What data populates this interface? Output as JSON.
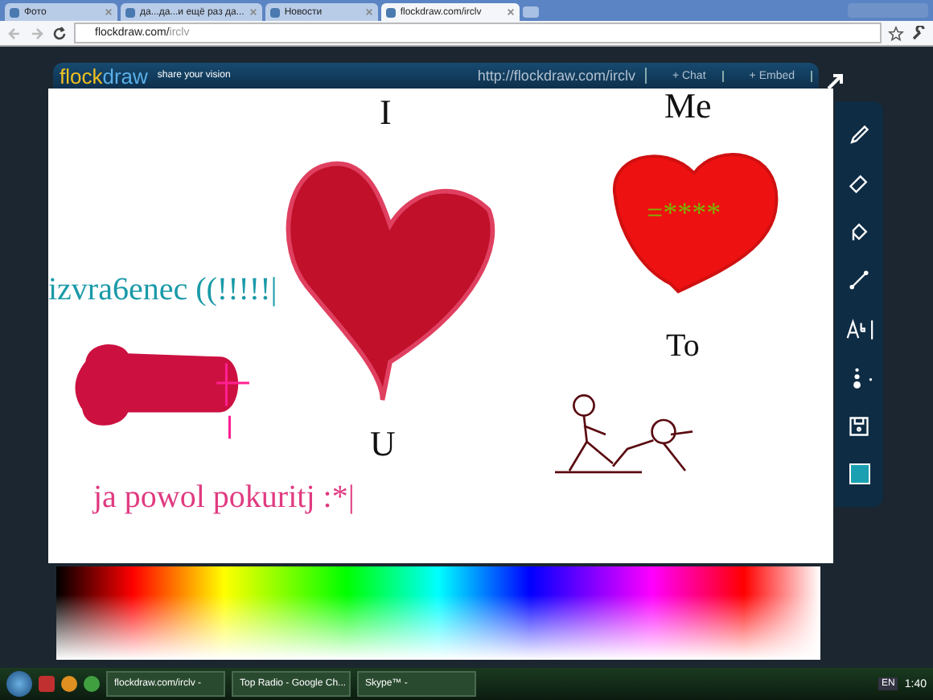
{
  "browser": {
    "tabs": [
      {
        "title": "Фото",
        "selected": false
      },
      {
        "title": "да...да...и ещё раз да...",
        "selected": false
      },
      {
        "title": "Новости",
        "selected": false
      },
      {
        "title": "flockdraw.com/irclv",
        "selected": true
      }
    ],
    "address": {
      "domain": "flockdraw.com/",
      "path": "irclv"
    }
  },
  "header": {
    "logo_a": "flock",
    "logo_b": "draw",
    "tagline": "share your vision",
    "room_url": "http://flockdraw.com/irclv",
    "buttons": [
      "+ Chat",
      "+ Embed"
    ]
  },
  "canvas": {
    "texts": [
      {
        "text": "I",
        "color": "#111111"
      },
      {
        "text": "Me",
        "color": "#111111"
      },
      {
        "text": "izvra6enec ((!!!!!|",
        "color": "#1a9aa8"
      },
      {
        "text": "=****",
        "color": "#7ab800"
      },
      {
        "text": "To",
        "color": "#111111"
      },
      {
        "text": "U",
        "color": "#111111"
      },
      {
        "text": "ja powol pokuritj :*|",
        "color": "#e03a80"
      }
    ]
  },
  "tools": [
    {
      "kind": "pencil"
    },
    {
      "kind": "eraser"
    },
    {
      "kind": "fill"
    },
    {
      "kind": "line"
    },
    {
      "kind": "text"
    },
    {
      "kind": "size"
    },
    {
      "kind": "save"
    },
    {
      "kind": "color",
      "color": "#1aa0b0"
    }
  ],
  "taskbar": {
    "items": [
      "flockdraw.com/irclv -",
      "Top Radio - Google Ch...",
      "Skype™ -"
    ],
    "language": "EN",
    "clock": "1:40"
  }
}
